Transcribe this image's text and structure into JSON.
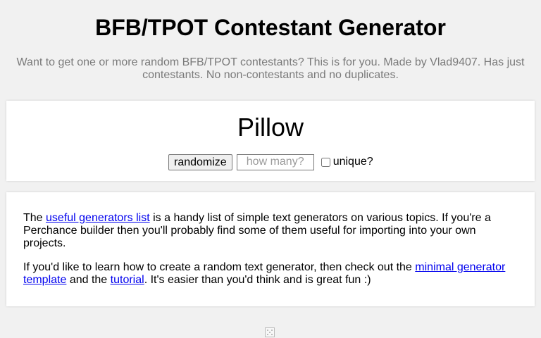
{
  "header": {
    "title": "BFB/TPOT Contestant Generator",
    "subtitle": "Want to get one or more random BFB/TPOT contestants? This is for you. Made by Vlad9407. Has just contestants. No non-contestants and no duplicates."
  },
  "generator": {
    "output": "Pillow",
    "randomize_label": "randomize",
    "count_placeholder": "how many?",
    "count_value": "",
    "unique_label": "unique?",
    "unique_checked": false
  },
  "info": {
    "p1_before": "The ",
    "p1_link": "useful generators list",
    "p1_after": " is a handy list of simple text generators on various topics. If you're a Perchance builder then you'll probably find some of them useful for importing into your own projects.",
    "p2_before": "If you'd like to learn how to create a random text generator, then check out the ",
    "p2_link1": "minimal generator template",
    "p2_mid": " and the ",
    "p2_link2": "tutorial",
    "p2_after": ". It's easier than you'd think and is great fun :)"
  },
  "footer": {
    "icon": "dice-icon"
  }
}
